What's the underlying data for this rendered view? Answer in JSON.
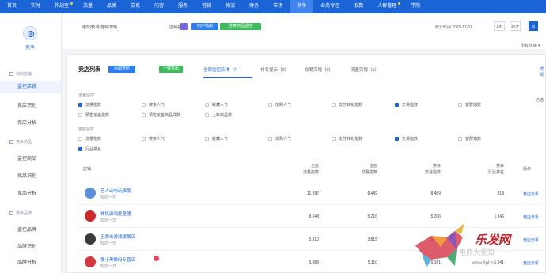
{
  "topnav": {
    "items": [
      {
        "label": "首页",
        "active": false,
        "dot": false
      },
      {
        "label": "实时",
        "active": false,
        "dot": false
      },
      {
        "label": "作战室",
        "active": false,
        "dot": true
      },
      {
        "label": "流量",
        "active": false,
        "dot": false
      },
      {
        "label": "品类",
        "active": false,
        "dot": false
      },
      {
        "label": "交易",
        "active": false,
        "dot": false
      },
      {
        "label": "内容",
        "active": false,
        "dot": false
      },
      {
        "label": "服务",
        "active": false,
        "dot": false
      },
      {
        "label": "营销",
        "active": false,
        "dot": false
      },
      {
        "label": "物流",
        "active": false,
        "dot": false
      },
      {
        "label": "财务",
        "active": false,
        "dot": false
      },
      {
        "label": "市场",
        "active": false,
        "dot": false
      },
      {
        "label": "竞争",
        "active": true,
        "dot": false
      },
      {
        "label": "业务专区",
        "active": false,
        "dot": false
      },
      {
        "label": "取数",
        "active": false,
        "dot": false
      },
      {
        "label": "人群管理",
        "active": false,
        "dot": true
      },
      {
        "label": "学院",
        "active": false,
        "dot": false
      }
    ]
  },
  "sidebar": {
    "logo_text": "竞争",
    "sections": [
      {
        "label": "我的店铺"
      },
      {
        "label": "竞争商品"
      },
      {
        "label": "竞争品牌"
      }
    ],
    "items": [
      {
        "label": "监控店铺",
        "active": true
      },
      {
        "label": "竞店识别",
        "active": false
      },
      {
        "label": "竞店分析",
        "active": false
      },
      {
        "label": "监控商品",
        "active": false
      },
      {
        "label": "竞品识别",
        "active": false
      },
      {
        "label": "竞品分析",
        "active": false
      },
      {
        "label": "监控品牌",
        "active": false
      },
      {
        "label": "品牌识别",
        "active": false
      },
      {
        "label": "品牌分析",
        "active": false
      }
    ]
  },
  "filter": {
    "breadcrumb": "电玩/動漫/游戏/攻略",
    "compare_label": "店铺名",
    "buttons": {
      "user_guide": "用户指南",
      "compare_monitor": "任意商品监控"
    },
    "stat_time": "统计时间 2019-12-31",
    "periods": [
      "1天",
      "30天",
      "日"
    ],
    "terminal": "所有终端"
  },
  "panel": {
    "title": "竞店列表",
    "buttons": {
      "add": "添加竞店",
      "export": "一键导出"
    },
    "tabs": [
      "全部监控店铺（7）",
      "排名提示（0）",
      "交易突增（0）",
      "流量突增（1）"
    ],
    "help": "帮助",
    "selected_count": "已选",
    "group1_label": "流量监控",
    "group2_label": "类目监控",
    "group1_checks": [
      {
        "label": "流量指数",
        "on": true
      },
      {
        "label": "搜索人气",
        "on": false
      },
      {
        "label": "收藏人气",
        "on": false
      },
      {
        "label": "加购人气",
        "on": false
      },
      {
        "label": "支付转化指数",
        "on": false
      },
      {
        "label": "交易指数",
        "on": true
      },
      {
        "label": "客群指数",
        "on": false
      },
      {
        "label": "预售定金指数",
        "on": false
      },
      {
        "label": "预售定金商品件数",
        "on": false
      },
      {
        "label": "上新商品数",
        "on": false
      }
    ],
    "group2_checks": [
      {
        "label": "流量指数",
        "on": false
      },
      {
        "label": "搜索人气",
        "on": false
      },
      {
        "label": "收藏人气",
        "on": false
      },
      {
        "label": "加购人气",
        "on": false
      },
      {
        "label": "支付转化指数",
        "on": false
      },
      {
        "label": "交易指数",
        "on": true
      },
      {
        "label": "客群指数",
        "on": false
      },
      {
        "label": "行业排名",
        "on": true
      }
    ]
  },
  "table": {
    "headers": {
      "shop": "店铺",
      "col1": [
        "全店",
        "流量指数"
      ],
      "col2": [
        "全店",
        "交易指数"
      ],
      "col3": [
        "类目",
        "交易指数"
      ],
      "col4": [
        "类目",
        "行业排名"
      ],
      "action": "操作"
    },
    "rows": [
      {
        "name": "艺人动电玩旗舰",
        "sub": "较前一日",
        "c1": "11,997",
        "c2": "8,449",
        "c3": "8,469",
        "c4": "818",
        "action": "竞店分析",
        "color": "#5b8fd9"
      },
      {
        "name": "神机游戏度量器",
        "sub": "较前一日",
        "c1": "8,048",
        "c2": "5,216",
        "c3": "5,206",
        "c4": "1,846",
        "action": "竞店分析",
        "color": "#cc2a2a"
      },
      {
        "name": "王牌去游戏旗舰店",
        "sub": "较前一日",
        "c1": "5,310",
        "c2": "3,815",
        "c3": "3,810",
        "c4": "2,133",
        "action": "竞店分析",
        "color": "#3a3a3a"
      },
      {
        "name": "萝小黑数码专营店",
        "sub": "较前一日",
        "c1": "5,089",
        "c2": "5,110",
        "c3": "5,161",
        "c4": "1,941",
        "action": "竞店分析",
        "color": "#d6363f"
      }
    ]
  },
  "watermark": {
    "brand": "乐发网",
    "sub": "电商大麦知",
    "site": "www.6pf.cn"
  }
}
